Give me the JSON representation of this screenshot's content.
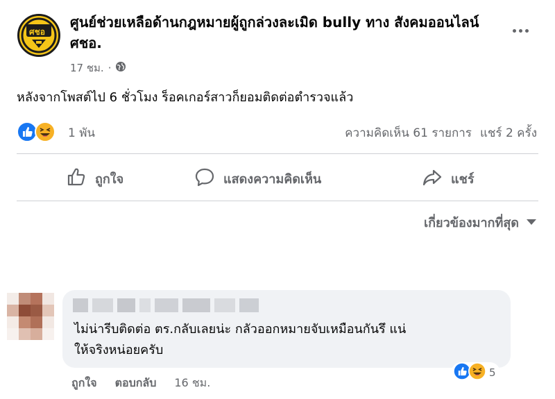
{
  "post": {
    "page_name": "ศูนย์ช่วยเหลือด้านกฎหมายผู้ถูกล่วงละเมิด bully ทาง สังคมออนไลน์ ศชอ.",
    "logo_text": "ศชอ",
    "time": "17 ชม.",
    "privacy_icon": "globe-icon",
    "text": "หลังจากโพสต์ไป 6 ชั่วโมง ร็อคเกอร์สาวก็ยอมติดต่อตำรวจแล้ว",
    "reaction_count": "1 พัน",
    "comments_count": "ความคิดเห็น 61 รายการ",
    "shares_count": "แชร์ 2 ครั้ง"
  },
  "actions": {
    "like": "ถูกใจ",
    "comment": "แสดงความคิดเห็น",
    "share": "แชร์"
  },
  "sort": {
    "label": "เกี่ยวข้องมากที่สุด"
  },
  "comment": {
    "line1": "ไม่น่ารีบติดต่อ ตร.กลับเลยน่ะ กลัวออกหมายจับเหมือนกันรึ แน่",
    "line2": "ให้จริงหน่อยครับ",
    "reaction_count": "5",
    "like_label": "ถูกใจ",
    "reply_label": "ตอบกลับ",
    "time": "16 ชม."
  },
  "colors": {
    "like_blue": "#1877f2",
    "haha_yellow": "#f7b125",
    "secondary_text": "#65676b",
    "bubble_bg": "#f0f2f5"
  }
}
